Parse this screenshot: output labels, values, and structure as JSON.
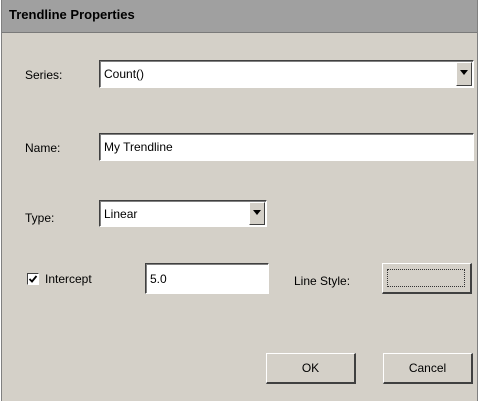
{
  "dialog": {
    "title": "Trendline Properties"
  },
  "series": {
    "label": "Series:",
    "value": "Count()"
  },
  "name": {
    "label": "Name:",
    "value": "My Trendline"
  },
  "type": {
    "label": "Type:",
    "value": "Linear"
  },
  "intercept": {
    "label": "Intercept",
    "checked": true,
    "value": "5.0"
  },
  "line_style": {
    "label": "Line Style:"
  },
  "buttons": {
    "ok": "OK",
    "cancel": "Cancel"
  },
  "icons": {
    "dropdown": "chevron-down-icon",
    "check": "checkmark-icon"
  }
}
